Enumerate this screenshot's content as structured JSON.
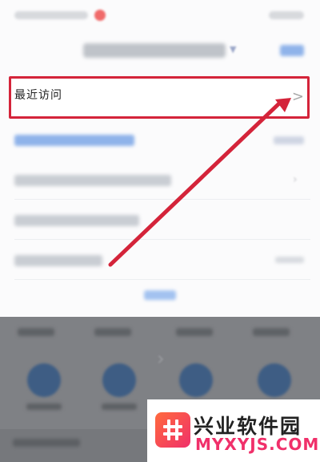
{
  "recent_visits": {
    "label": "最近访问",
    "chevron": ">"
  },
  "watermark": {
    "brand_cn": "兴业软件园",
    "brand_en": "MYXYJS.COM"
  },
  "colors": {
    "highlight": "#d4243a",
    "brand_pink": "#f0306a",
    "brand_orange": "#ff6a3d"
  },
  "icons": [
    "chevron-right-icon",
    "annotation-arrow",
    "site-logo-icon"
  ]
}
